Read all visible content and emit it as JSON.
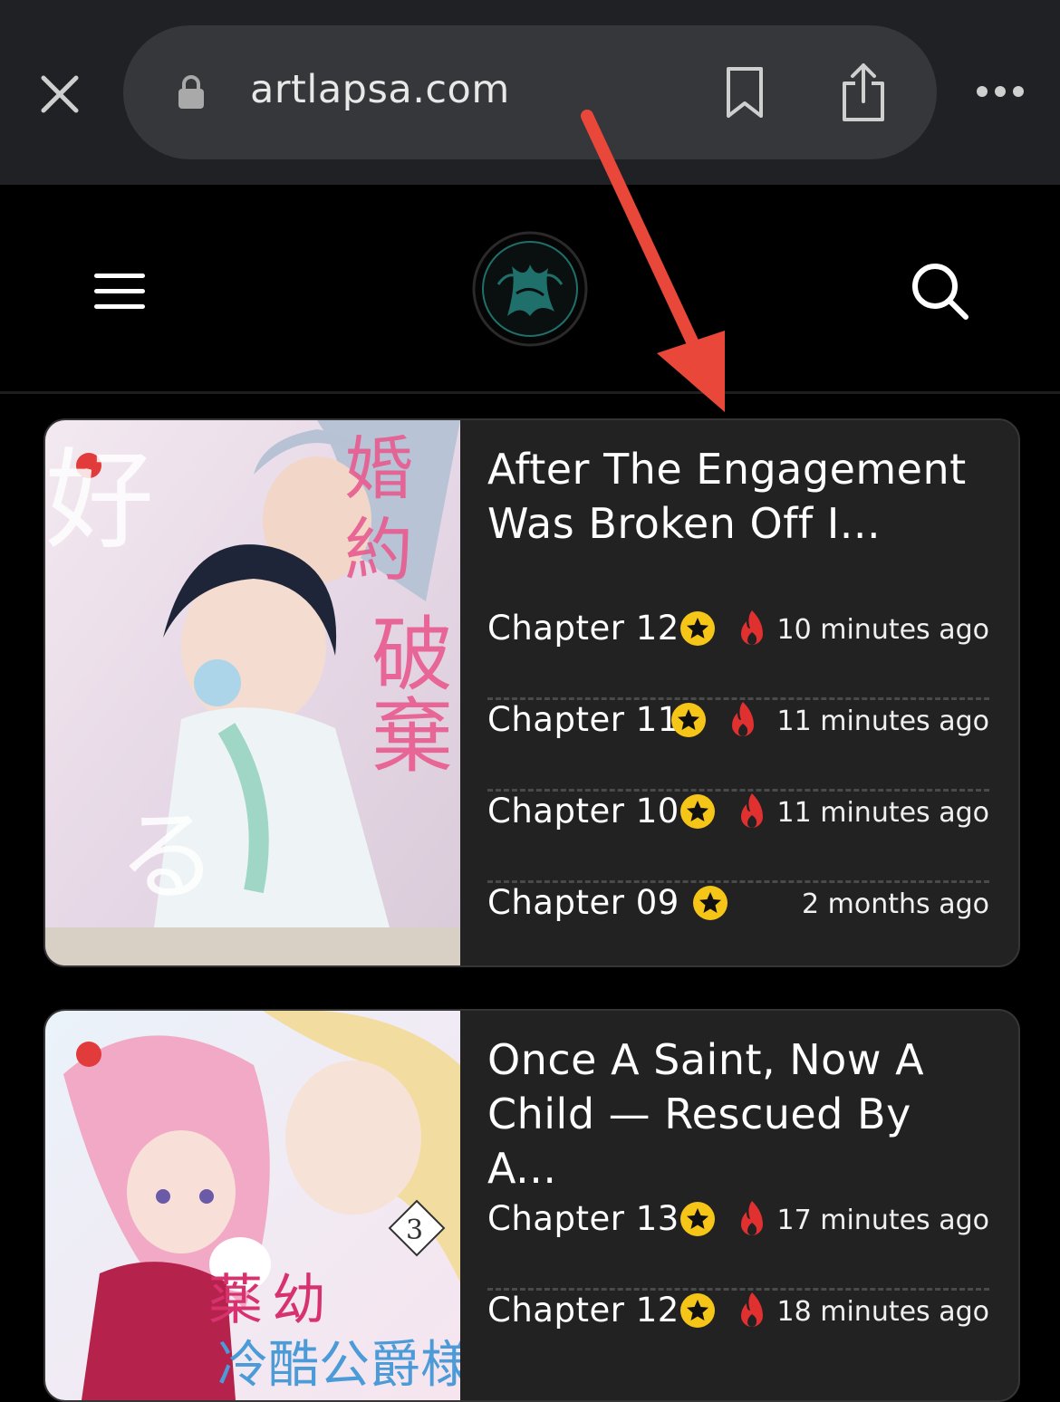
{
  "browser": {
    "url": "artlapsa.com"
  },
  "manga": [
    {
      "title": "After The Engagement Was Broken Off I...",
      "chapters": [
        {
          "label": "Chapter 12",
          "time": "10 minutes ago",
          "hot": true
        },
        {
          "label": "Chapter 11",
          "time": "11 minutes ago",
          "hot": true
        },
        {
          "label": "Chapter 10",
          "time": "11 minutes ago",
          "hot": true
        },
        {
          "label": "Chapter 09",
          "time": "2 months ago",
          "hot": false
        }
      ]
    },
    {
      "title": "Once A Saint, Now A Child — Rescued By A...",
      "chapters": [
        {
          "label": "Chapter 13",
          "time": "17 minutes ago",
          "hot": true
        },
        {
          "label": "Chapter 12",
          "time": "18 minutes ago",
          "hot": true
        }
      ]
    }
  ],
  "colors": {
    "browser_bar": "#202124",
    "url_pill": "#36373a",
    "card_bg": "#222222",
    "star": "#f5c518",
    "fire": "#e03030",
    "annotation_arrow": "#e8473a",
    "logo_accent": "#1f6f6a"
  }
}
